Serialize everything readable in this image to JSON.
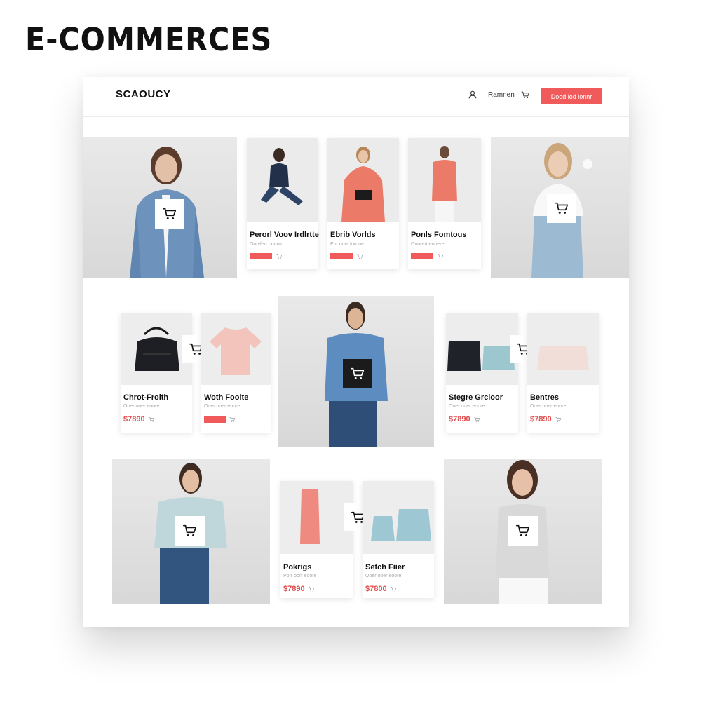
{
  "page_heading": "E-COMMERCES",
  "header": {
    "logo": "SCAOUCY",
    "account_label": "Ramnen",
    "cta_label": "Dood lod ionnr"
  },
  "icons": [
    "user-icon",
    "cart-icon"
  ],
  "colors": {
    "accent": "#f15a5a",
    "price": "#e24c4c"
  },
  "products": {
    "p1": {
      "title": "Perorl Voov Irdlrtte",
      "subtitle": "Oorvlert ooorw"
    },
    "p2": {
      "title": "Ebrib Vorlds",
      "subtitle": "Ebr onvt foroue"
    },
    "p3": {
      "title": "Ponls Fomtous",
      "subtitle": "Ooorert eooere"
    },
    "p4": {
      "title": "Chrot-Frolth",
      "subtitle": "Ooer ooer eoore",
      "price": "$7890"
    },
    "p5": {
      "title": "Woth Foolte",
      "subtitle": "Ooer ooer eoore"
    },
    "p6": {
      "title": "Stegre Grcloor",
      "subtitle": "Ooer ooer eoore",
      "price": "$7890"
    },
    "p7": {
      "title": "Bentres",
      "subtitle": "Ooer ooer eoore",
      "price": "$7890"
    },
    "p8": {
      "title": "Pokrigs",
      "subtitle": "Porr oorr eoore",
      "price": "$7890"
    },
    "p9": {
      "title": "Setch Fiier",
      "subtitle": "Ooer ooer eoore",
      "price": "$7800"
    }
  }
}
